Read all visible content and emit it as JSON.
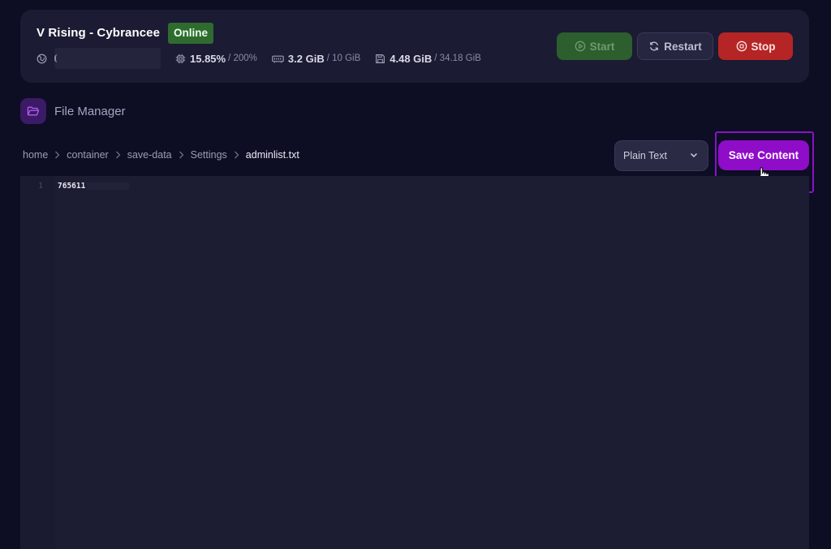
{
  "server": {
    "name": "V Rising - Cybrancee",
    "status": "Online",
    "stats": {
      "cpu_value": "15.85%",
      "cpu_max": "/ 200%",
      "memory_value": "3.2 GiB",
      "memory_max": "/ 10 GiB",
      "disk_value": "4.48 GiB",
      "disk_max": "/ 34.18 GiB"
    },
    "controls": {
      "start_label": "Start",
      "restart_label": "Restart",
      "stop_label": "Stop"
    }
  },
  "file_manager": {
    "title": "File Manager",
    "breadcrumb": [
      "home",
      "container",
      "save-data",
      "Settings",
      "adminlist.txt"
    ],
    "syntax_mode": "Plain Text",
    "save_label": "Save Content"
  },
  "editor": {
    "lines": [
      {
        "number": "1",
        "text": "765611"
      }
    ]
  },
  "colors": {
    "accent": "#8f0cc9",
    "online": "#2f6b2f",
    "start": "#2d5e2d",
    "stop": "#b52525",
    "background": "#0d0d24",
    "card": "#1b1b33"
  }
}
